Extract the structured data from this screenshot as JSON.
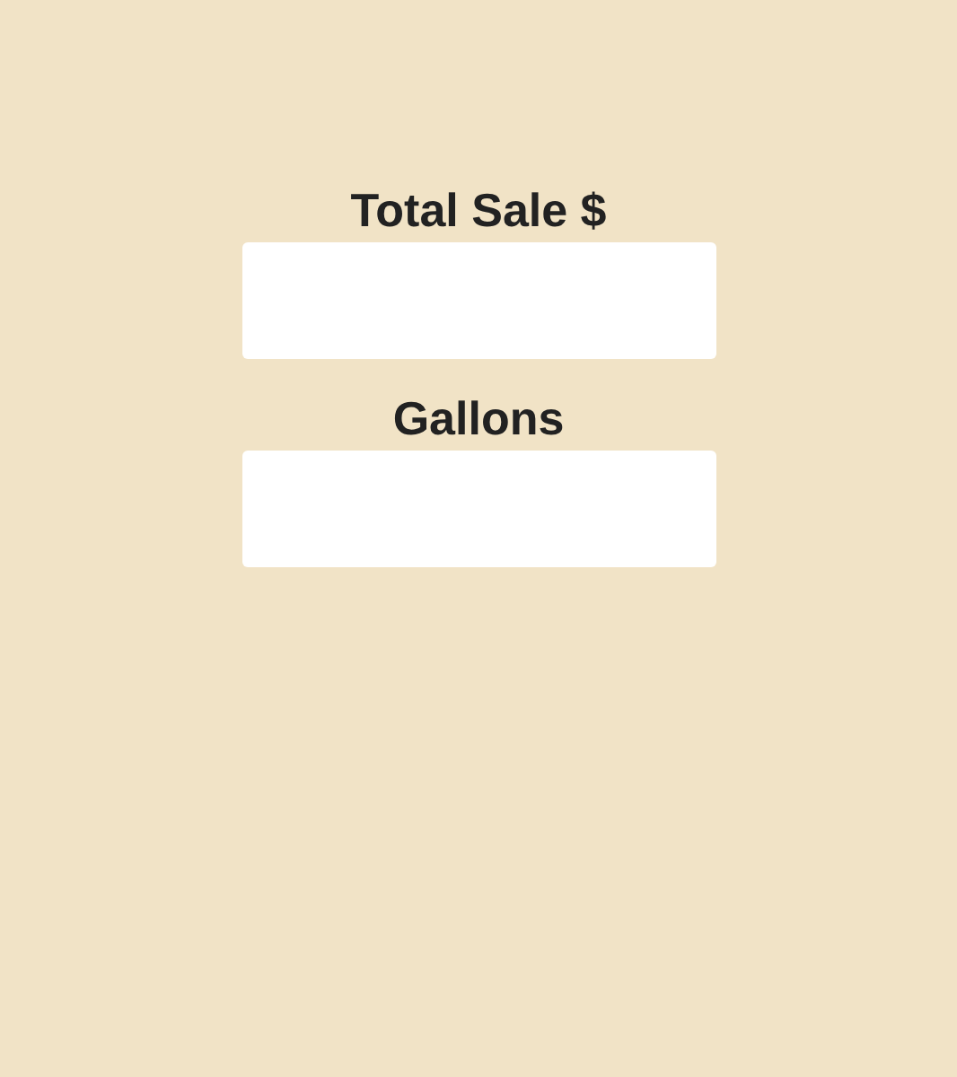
{
  "fields": [
    {
      "label": "Total Sale $"
    },
    {
      "label": "Gallons"
    }
  ]
}
